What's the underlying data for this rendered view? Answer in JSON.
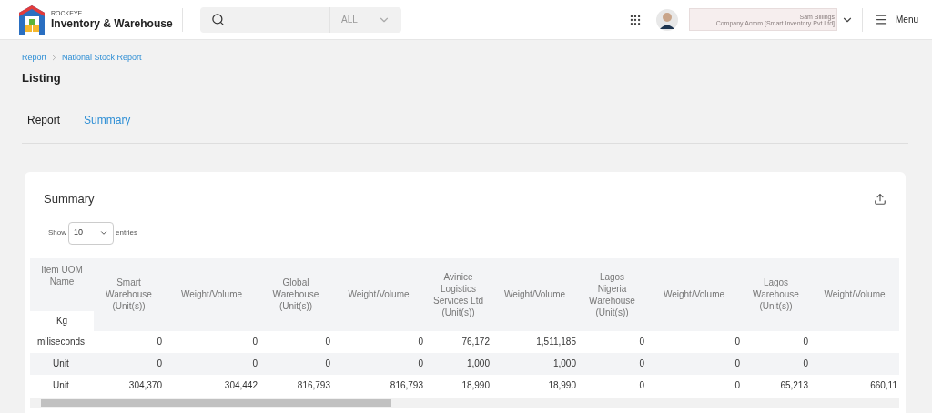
{
  "header": {
    "brand_small": "ROCKEYE",
    "brand": "Inventory & Warehouse",
    "search": {
      "scope": "ALL"
    },
    "account": {
      "name": "Sam Billings",
      "company": "Company Acmm [Smart Inventory Pvt Ltd]"
    },
    "menu": "Menu"
  },
  "breadcrumb": [
    "Report",
    "National Stock Report"
  ],
  "page_title": "Listing",
  "tabs": [
    {
      "label": "Report",
      "selected": false
    },
    {
      "label": "Summary",
      "selected": true
    }
  ],
  "card": {
    "title": "Summary",
    "show_label": "Show",
    "entries_value": "10",
    "entries_label": "entries",
    "table": {
      "columns": [
        "Item UOM Name",
        "Smart Warehouse (Unit(s))",
        "Weight/Volume",
        "Global Warehouse (Unit(s))",
        "Weight/Volume",
        "Avinice Logistics Services Ltd (Unit(s))",
        "Weight/Volume",
        "Lagos Nigeria Warehouse (Unit(s))",
        "Weight/Volume",
        "Lagos Warehouse (Unit(s))",
        "Weight/Volume"
      ],
      "overlay_cell": "Kg",
      "rows": [
        [
          "miliseconds",
          "0",
          "0",
          "0",
          "0",
          "76,172",
          "1,511,185",
          "0",
          "0",
          "0",
          ""
        ],
        [
          "Unit",
          "0",
          "0",
          "0",
          "0",
          "1,000",
          "1,000",
          "0",
          "0",
          "0",
          ""
        ],
        [
          "Unit",
          "304,370",
          "304,442",
          "816,793",
          "816,793",
          "18,990",
          "18,990",
          "0",
          "0",
          "65,213",
          "660,11"
        ]
      ]
    }
  }
}
